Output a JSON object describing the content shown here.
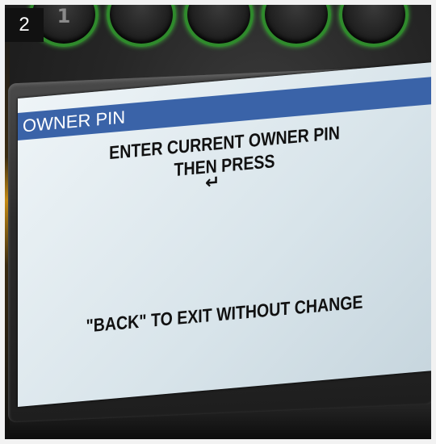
{
  "step": {
    "number": "2"
  },
  "keys": [
    {
      "name": "key-1",
      "glyph": "1"
    },
    {
      "name": "key-2",
      "glyph": ""
    },
    {
      "name": "key-3",
      "glyph": ""
    },
    {
      "name": "key-4",
      "glyph": ""
    },
    {
      "name": "key-5",
      "glyph": ""
    }
  ],
  "screen": {
    "title": "OWNER PIN",
    "line1": "ENTER CURRENT OWNER PIN",
    "line2": "THEN PRESS",
    "enter_icon": "↵",
    "footer": "\"BACK\" TO EXIT WITHOUT CHANGE"
  },
  "colors": {
    "title_bar": "#3a63a8",
    "key_ring": "#2f8a2c",
    "screen_bg": "#e3ecf1"
  },
  "icons": [
    "enter-key-icon"
  ]
}
